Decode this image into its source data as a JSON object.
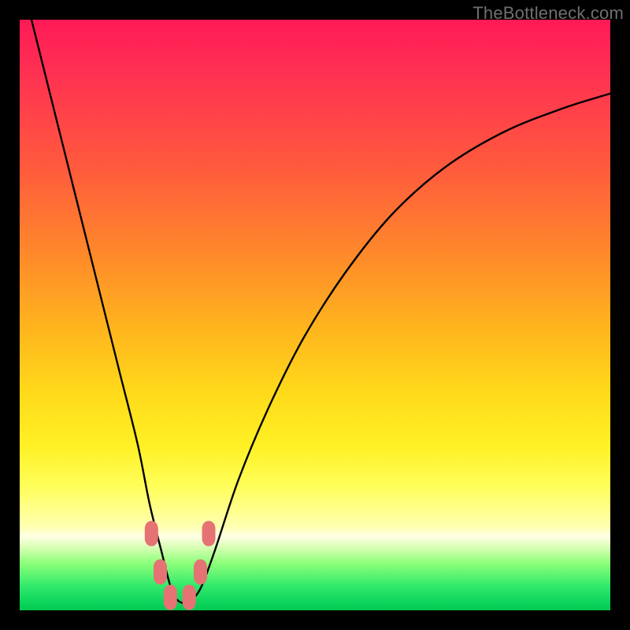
{
  "watermark": "TheBottleneck.com",
  "colors": {
    "page_bg": "#000000",
    "curve_stroke": "#000000",
    "marker_fill": "#e57373",
    "marker_stroke": "#c85a5a",
    "gradient_stops": [
      "#ff1a56",
      "#ff2e53",
      "#ff5a3d",
      "#ff8a2a",
      "#ffb41e",
      "#ffd91a",
      "#fff024",
      "#ffff5a",
      "#ffffb0",
      "#ffffe4",
      "#d8ffb5",
      "#8dff7a",
      "#2fe86a",
      "#09d25a",
      "#06c94f"
    ]
  },
  "chart_data": {
    "type": "line",
    "title": "",
    "xlabel": "",
    "ylabel": "",
    "xlim": [
      0,
      100
    ],
    "ylim": [
      0,
      100
    ],
    "grid": false,
    "legend": false,
    "comment": "V-shaped bottleneck curve. x roughly 0–100 (relative), y is mismatch % (0 at dip, ~100 at top). Values estimated from pixel positions.",
    "series": [
      {
        "name": "bottleneck-curve",
        "x": [
          2,
          5,
          8,
          11,
          14,
          17,
          20,
          22,
          24,
          25.7,
          27,
          28.5,
          30.5,
          33,
          37,
          42,
          48,
          55,
          63,
          72,
          82,
          92,
          100
        ],
        "y": [
          100,
          88,
          76,
          64,
          52,
          40,
          28,
          18,
          10,
          3.5,
          1.5,
          1.5,
          3.5,
          10,
          22,
          34,
          46,
          57,
          67,
          75,
          81,
          85,
          87.5
        ]
      }
    ],
    "markers": [
      {
        "x": 22.3,
        "y": 13.0
      },
      {
        "x": 23.8,
        "y": 6.5
      },
      {
        "x": 25.5,
        "y": 2.2
      },
      {
        "x": 28.7,
        "y": 2.2
      },
      {
        "x": 30.6,
        "y": 6.5
      },
      {
        "x": 32.0,
        "y": 13.0
      }
    ],
    "dip_x": 27.1
  }
}
